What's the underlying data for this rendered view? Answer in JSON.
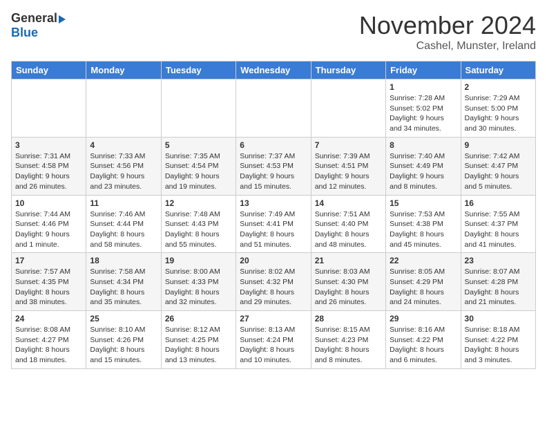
{
  "header": {
    "logo_general": "General",
    "logo_blue": "Blue",
    "month_title": "November 2024",
    "subtitle": "Cashel, Munster, Ireland"
  },
  "calendar": {
    "days_of_week": [
      "Sunday",
      "Monday",
      "Tuesday",
      "Wednesday",
      "Thursday",
      "Friday",
      "Saturday"
    ],
    "weeks": [
      [
        {
          "day": "",
          "info": ""
        },
        {
          "day": "",
          "info": ""
        },
        {
          "day": "",
          "info": ""
        },
        {
          "day": "",
          "info": ""
        },
        {
          "day": "",
          "info": ""
        },
        {
          "day": "1",
          "info": "Sunrise: 7:28 AM\nSunset: 5:02 PM\nDaylight: 9 hours and 34 minutes."
        },
        {
          "day": "2",
          "info": "Sunrise: 7:29 AM\nSunset: 5:00 PM\nDaylight: 9 hours and 30 minutes."
        }
      ],
      [
        {
          "day": "3",
          "info": "Sunrise: 7:31 AM\nSunset: 4:58 PM\nDaylight: 9 hours and 26 minutes."
        },
        {
          "day": "4",
          "info": "Sunrise: 7:33 AM\nSunset: 4:56 PM\nDaylight: 9 hours and 23 minutes."
        },
        {
          "day": "5",
          "info": "Sunrise: 7:35 AM\nSunset: 4:54 PM\nDaylight: 9 hours and 19 minutes."
        },
        {
          "day": "6",
          "info": "Sunrise: 7:37 AM\nSunset: 4:53 PM\nDaylight: 9 hours and 15 minutes."
        },
        {
          "day": "7",
          "info": "Sunrise: 7:39 AM\nSunset: 4:51 PM\nDaylight: 9 hours and 12 minutes."
        },
        {
          "day": "8",
          "info": "Sunrise: 7:40 AM\nSunset: 4:49 PM\nDaylight: 9 hours and 8 minutes."
        },
        {
          "day": "9",
          "info": "Sunrise: 7:42 AM\nSunset: 4:47 PM\nDaylight: 9 hours and 5 minutes."
        }
      ],
      [
        {
          "day": "10",
          "info": "Sunrise: 7:44 AM\nSunset: 4:46 PM\nDaylight: 9 hours and 1 minute."
        },
        {
          "day": "11",
          "info": "Sunrise: 7:46 AM\nSunset: 4:44 PM\nDaylight: 8 hours and 58 minutes."
        },
        {
          "day": "12",
          "info": "Sunrise: 7:48 AM\nSunset: 4:43 PM\nDaylight: 8 hours and 55 minutes."
        },
        {
          "day": "13",
          "info": "Sunrise: 7:49 AM\nSunset: 4:41 PM\nDaylight: 8 hours and 51 minutes."
        },
        {
          "day": "14",
          "info": "Sunrise: 7:51 AM\nSunset: 4:40 PM\nDaylight: 8 hours and 48 minutes."
        },
        {
          "day": "15",
          "info": "Sunrise: 7:53 AM\nSunset: 4:38 PM\nDaylight: 8 hours and 45 minutes."
        },
        {
          "day": "16",
          "info": "Sunrise: 7:55 AM\nSunset: 4:37 PM\nDaylight: 8 hours and 41 minutes."
        }
      ],
      [
        {
          "day": "17",
          "info": "Sunrise: 7:57 AM\nSunset: 4:35 PM\nDaylight: 8 hours and 38 minutes."
        },
        {
          "day": "18",
          "info": "Sunrise: 7:58 AM\nSunset: 4:34 PM\nDaylight: 8 hours and 35 minutes."
        },
        {
          "day": "19",
          "info": "Sunrise: 8:00 AM\nSunset: 4:33 PM\nDaylight: 8 hours and 32 minutes."
        },
        {
          "day": "20",
          "info": "Sunrise: 8:02 AM\nSunset: 4:32 PM\nDaylight: 8 hours and 29 minutes."
        },
        {
          "day": "21",
          "info": "Sunrise: 8:03 AM\nSunset: 4:30 PM\nDaylight: 8 hours and 26 minutes."
        },
        {
          "day": "22",
          "info": "Sunrise: 8:05 AM\nSunset: 4:29 PM\nDaylight: 8 hours and 24 minutes."
        },
        {
          "day": "23",
          "info": "Sunrise: 8:07 AM\nSunset: 4:28 PM\nDaylight: 8 hours and 21 minutes."
        }
      ],
      [
        {
          "day": "24",
          "info": "Sunrise: 8:08 AM\nSunset: 4:27 PM\nDaylight: 8 hours and 18 minutes."
        },
        {
          "day": "25",
          "info": "Sunrise: 8:10 AM\nSunset: 4:26 PM\nDaylight: 8 hours and 15 minutes."
        },
        {
          "day": "26",
          "info": "Sunrise: 8:12 AM\nSunset: 4:25 PM\nDaylight: 8 hours and 13 minutes."
        },
        {
          "day": "27",
          "info": "Sunrise: 8:13 AM\nSunset: 4:24 PM\nDaylight: 8 hours and 10 minutes."
        },
        {
          "day": "28",
          "info": "Sunrise: 8:15 AM\nSunset: 4:23 PM\nDaylight: 8 hours and 8 minutes."
        },
        {
          "day": "29",
          "info": "Sunrise: 8:16 AM\nSunset: 4:22 PM\nDaylight: 8 hours and 6 minutes."
        },
        {
          "day": "30",
          "info": "Sunrise: 8:18 AM\nSunset: 4:22 PM\nDaylight: 8 hours and 3 minutes."
        }
      ]
    ]
  }
}
